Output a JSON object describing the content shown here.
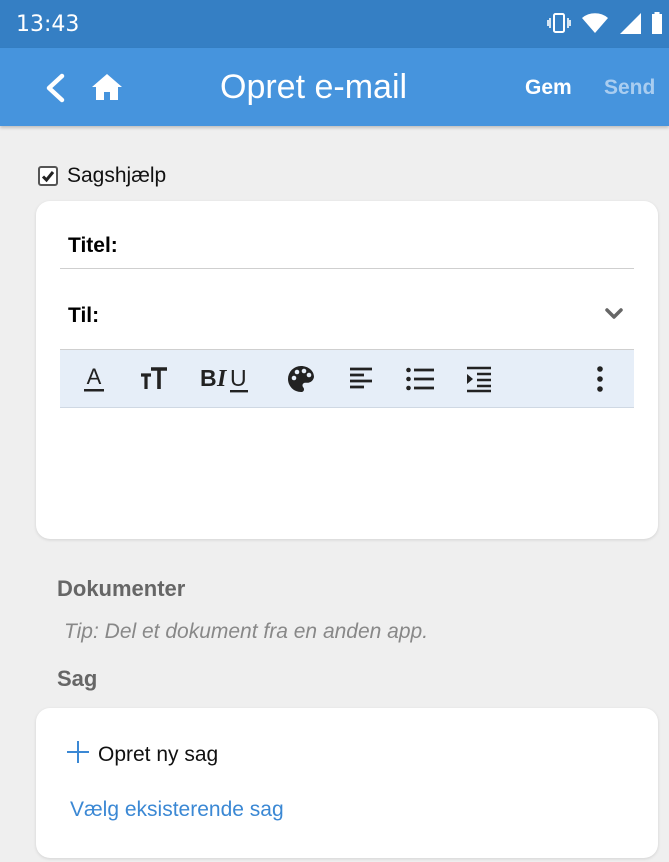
{
  "status_bar": {
    "time": "13:43",
    "icons": [
      "vibrate-icon",
      "wifi-icon",
      "signal-icon",
      "battery-icon"
    ]
  },
  "app_bar": {
    "title": "Opret e-mail",
    "save_label": "Gem",
    "send_label": "Send",
    "icons": [
      "back-chevron-icon",
      "home-icon"
    ]
  },
  "case_help": {
    "label": "Sagshjælp",
    "checked": true
  },
  "compose": {
    "title_label": "Titel:",
    "to_label": "Til:",
    "toolbar_icons": [
      "font-color-icon",
      "text-size-icon",
      "bold-italic-underline-icon",
      "palette-icon",
      "align-left-icon",
      "bullet-list-icon",
      "indent-icon",
      "more-vert-icon"
    ]
  },
  "documents": {
    "heading": "Dokumenter",
    "tip": "Tip: Del et dokument fra en anden app."
  },
  "case": {
    "heading": "Sag",
    "new_case_label": "Opret ny sag",
    "choose_existing_label": "Vælg eksisterende sag"
  },
  "colors": {
    "status_bar": "#357fc4",
    "app_bar": "#4694dd",
    "background": "#efefef",
    "toolbar": "#e6eef8",
    "link": "#3b88d4"
  }
}
